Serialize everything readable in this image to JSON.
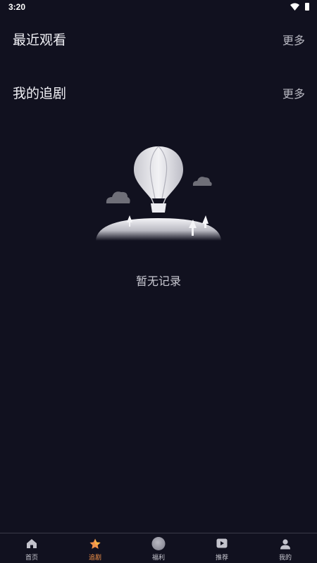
{
  "status_bar": {
    "time": "3:20"
  },
  "sections": {
    "recent": {
      "title": "最近观看",
      "more": "更多"
    },
    "following": {
      "title": "我的追剧",
      "more": "更多"
    }
  },
  "empty_state": {
    "text": "暂无记录"
  },
  "bottom_nav": {
    "items": [
      {
        "label": "首页",
        "icon": "home-icon",
        "active": false
      },
      {
        "label": "追剧",
        "icon": "star-icon",
        "active": true
      },
      {
        "label": "福利",
        "icon": "coin-icon",
        "active": false
      },
      {
        "label": "推荐",
        "icon": "play-icon",
        "active": false
      },
      {
        "label": "我的",
        "icon": "profile-icon",
        "active": false
      }
    ]
  },
  "colors": {
    "background": "#11111f",
    "accent": "#f2924a",
    "text_primary": "#f0f0f5",
    "text_secondary": "#b7b7c0"
  }
}
